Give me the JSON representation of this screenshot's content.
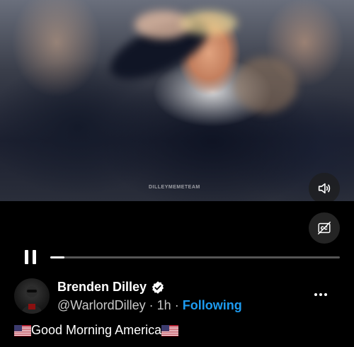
{
  "video": {
    "watermark": "DILLEYMEMETEAM",
    "volume_icon": "speaker-icon",
    "captions_icon": "captions-off-icon",
    "progress": 0.05
  },
  "player": {
    "play_state_icon": "pause-icon"
  },
  "author": {
    "name": "Brenden Dilley",
    "handle": "@WarlordDilley",
    "separator": "·",
    "time": "1h",
    "follow_status": "Following",
    "verified_icon": "verified-badge-icon",
    "accent_color": "#1d9bf0"
  },
  "tweet": {
    "text": "Good Morning America",
    "flag_icon": "us-flag-icon"
  },
  "more_icon": "more-options-icon"
}
